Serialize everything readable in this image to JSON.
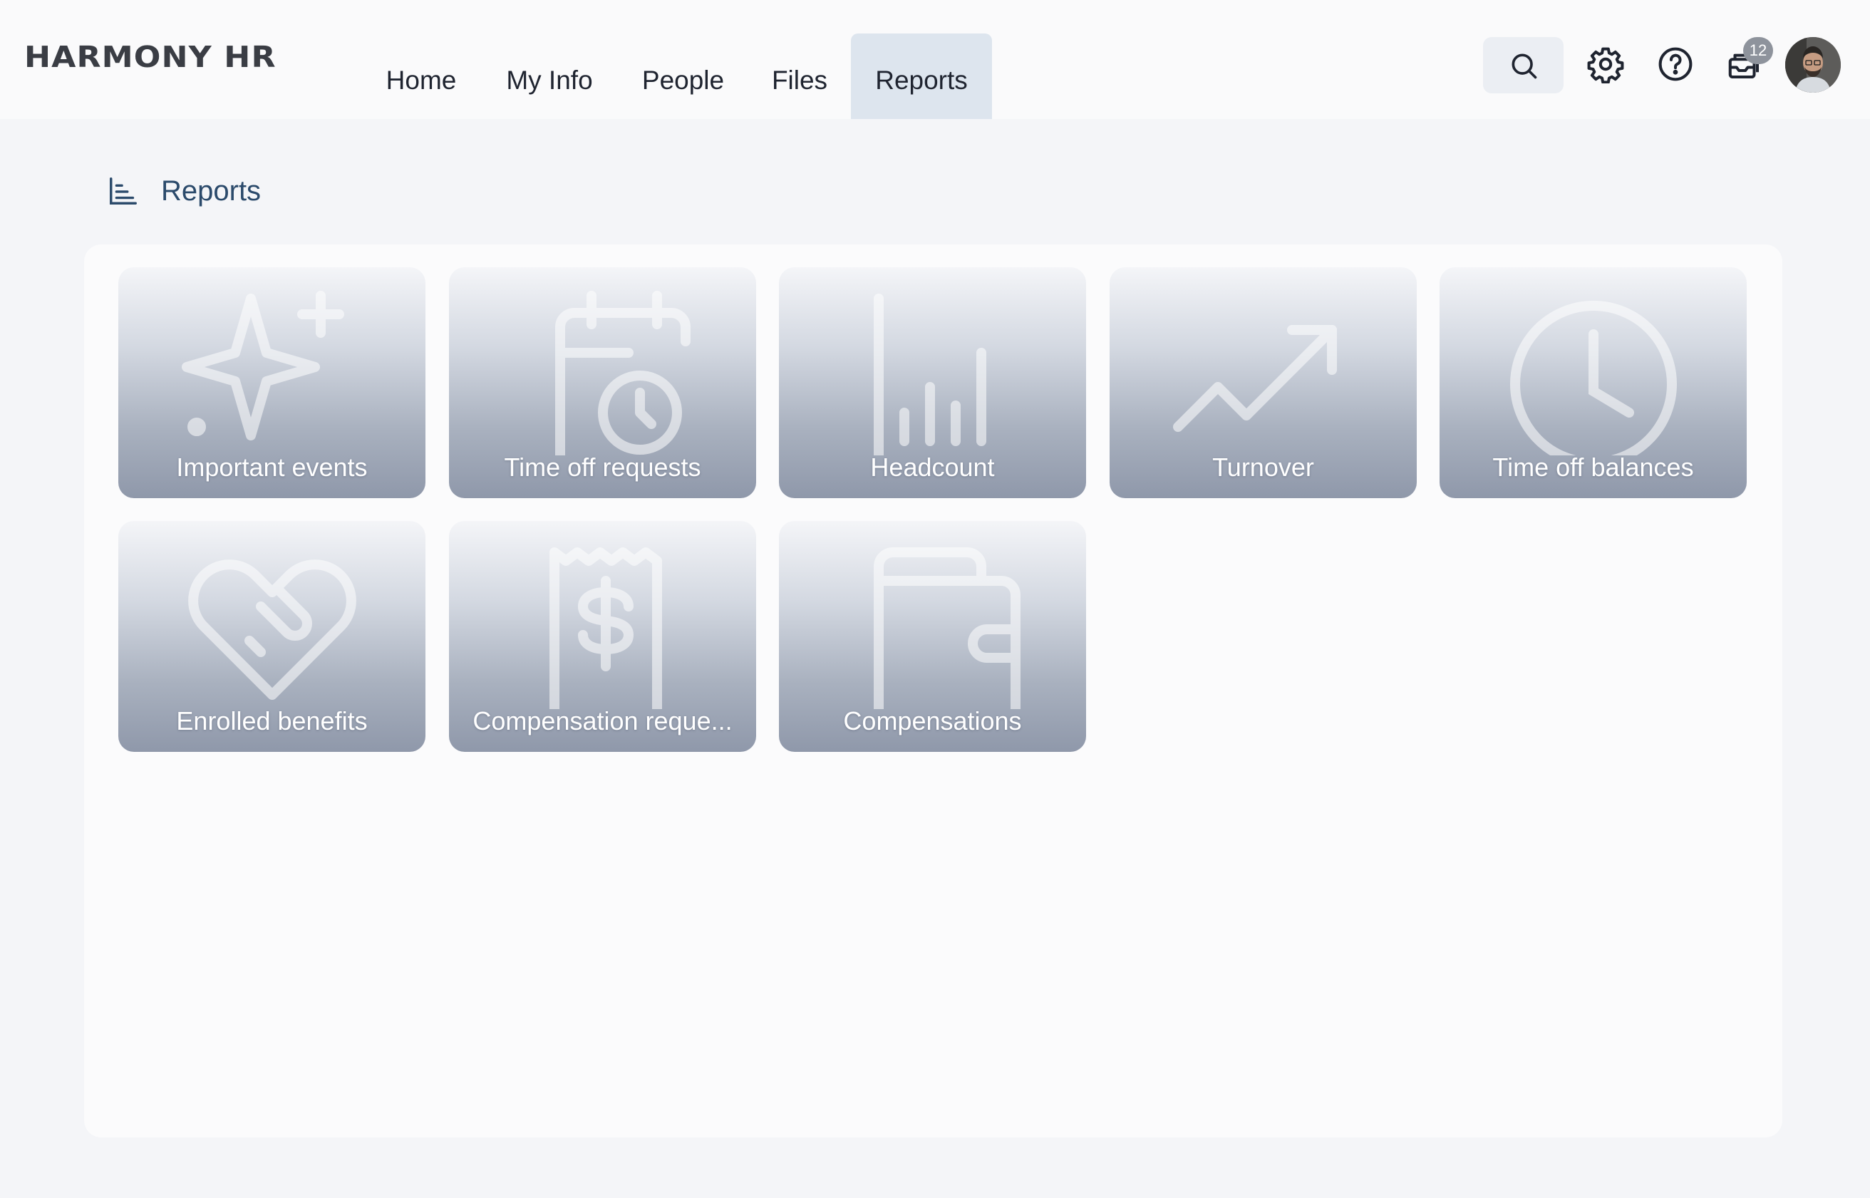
{
  "app": {
    "logo": "HARMONY HR"
  },
  "nav": {
    "items": [
      {
        "label": "Home"
      },
      {
        "label": "My Info"
      },
      {
        "label": "People"
      },
      {
        "label": "Files"
      },
      {
        "label": "Reports"
      }
    ],
    "active": "Reports"
  },
  "header_icons": [
    "search-icon",
    "gear-icon",
    "help-icon",
    "inbox-icon",
    "avatar"
  ],
  "notifications": {
    "count": "12"
  },
  "page": {
    "title": "Reports",
    "icon": "bar-chart-icon"
  },
  "reports": [
    {
      "label": "Important events",
      "icon": "sparkle-icon"
    },
    {
      "label": "Time off requests",
      "icon": "calendar-clock-icon"
    },
    {
      "label": "Headcount",
      "icon": "bar-chart-icon"
    },
    {
      "label": "Turnover",
      "icon": "trend-up-icon"
    },
    {
      "label": "Time off balances",
      "icon": "clock-icon"
    },
    {
      "label": "Enrolled benefits",
      "icon": "heart-handshake-icon"
    },
    {
      "label": "Compensation reque...",
      "icon": "receipt-dollar-icon"
    },
    {
      "label": "Compensations",
      "icon": "wallet-icon"
    }
  ],
  "colors": {
    "active_tab": "#dde5ee",
    "title": "#2b4a6b",
    "tile_gradient_bottom": "#8f98aa"
  }
}
